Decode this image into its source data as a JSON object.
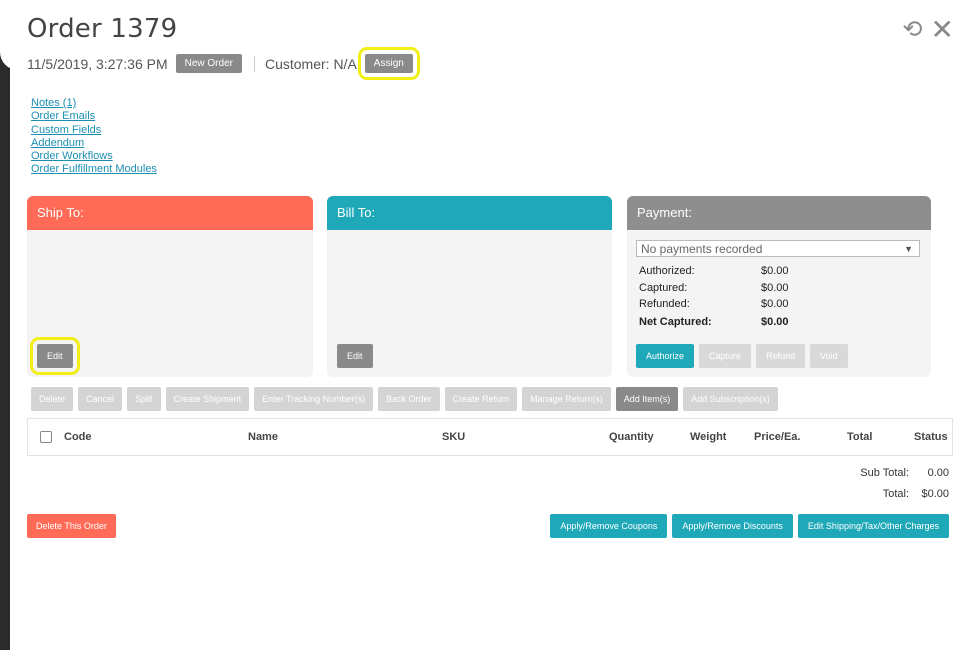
{
  "order": {
    "title": "Order 1379",
    "datetime": "11/5/2019, 3:27:36 PM",
    "status_tag": "New Order",
    "customer": "Customer: N/A",
    "assign_label": "Assign"
  },
  "header_icons": [
    "refresh-icon",
    "close-icon"
  ],
  "links": [
    "Notes (1)",
    "Order Emails",
    "Custom Fields",
    "Addendum",
    "Order Workflows",
    "Order Fulfillment Modules"
  ],
  "ship_to": {
    "title": "Ship To:",
    "edit_label": "Edit"
  },
  "bill_to": {
    "title": "Bill To:",
    "edit_label": "Edit"
  },
  "payment": {
    "title": "Payment:",
    "select_value": "No payments recorded",
    "rows": [
      {
        "label": "Authorized:",
        "value": "$0.00"
      },
      {
        "label": "Captured:",
        "value": "$0.00"
      },
      {
        "label": "Refunded:",
        "value": "$0.00"
      },
      {
        "label": "Net Captured:",
        "value": "$0.00"
      }
    ],
    "buttons": [
      "Authorize",
      "Capture",
      "Refund",
      "Void"
    ]
  },
  "actions": [
    "Delete",
    "Cancel",
    "Split",
    "Create Shipment",
    "Enter Tracking Number(s)",
    "Back Order",
    "Create Return",
    "Manage Return(s)",
    "Add Item(s)",
    "Add Subscription(s)"
  ],
  "table": {
    "columns": [
      "Code",
      "Name",
      "SKU",
      "Quantity",
      "Weight",
      "Price/Ea.",
      "Total",
      "Status"
    ]
  },
  "totals": {
    "subtotal_label": "Sub Total:",
    "subtotal_value": "0.00",
    "total_label": "Total:",
    "total_value": "$0.00"
  },
  "footer": {
    "delete_label": "Delete This Order",
    "coupons_label": "Apply/Remove Coupons",
    "discounts_label": "Apply/Remove Discounts",
    "charges_label": "Edit Shipping/Tax/Other Charges"
  },
  "colors": {
    "ship_head": "#ff6b57",
    "bill_head": "#1fa8b8",
    "pay_head": "#8e8e8e",
    "highlight": "#f2ef14"
  }
}
